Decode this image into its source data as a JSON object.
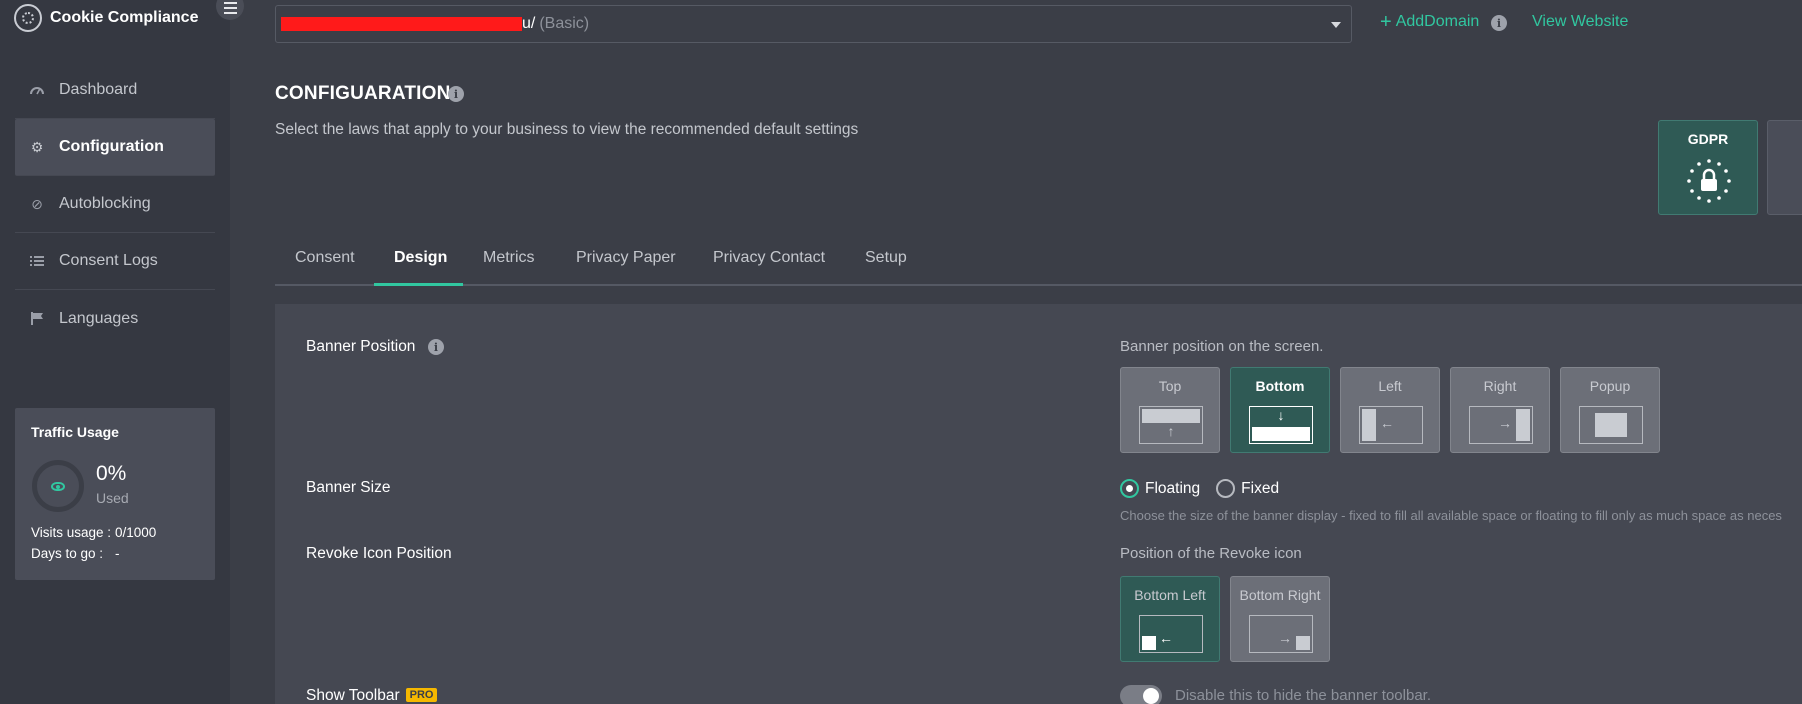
{
  "app": {
    "name": "Cookie Compliance"
  },
  "sidebar": {
    "items": [
      {
        "label": "Dashboard",
        "icon": "dashboard-icon"
      },
      {
        "label": "Configuration",
        "icon": "gear-icon",
        "active": true
      },
      {
        "label": "Autoblocking",
        "icon": "block-icon"
      },
      {
        "label": "Consent Logs",
        "icon": "list-icon"
      },
      {
        "label": "Languages",
        "icon": "flag-icon"
      }
    ],
    "traffic": {
      "title": "Traffic Usage",
      "percent": "0%",
      "used_label": "Used",
      "visits_label": "Visits usage :",
      "visits_value": "0/1000",
      "days_label": "Days to go :",
      "days_value": "-"
    }
  },
  "topbar": {
    "domain_suffix": "u/",
    "domain_plan": "(Basic)",
    "add_domain": "AddDomain",
    "view_website": "View Website"
  },
  "header": {
    "title": "CONFIGUARATION",
    "subtitle": "Select the laws that apply to your business to view the recommended default settings",
    "laws": [
      {
        "name": "GDPR",
        "selected": true
      }
    ]
  },
  "tabs": [
    {
      "label": "Consent"
    },
    {
      "label": "Design",
      "active": true
    },
    {
      "label": "Metrics"
    },
    {
      "label": "Privacy Paper"
    },
    {
      "label": "Privacy Contact"
    },
    {
      "label": "Setup"
    }
  ],
  "design": {
    "banner_position": {
      "label": "Banner Position",
      "hint": "Banner position on the screen.",
      "options": [
        {
          "label": "Top"
        },
        {
          "label": "Bottom",
          "selected": true
        },
        {
          "label": "Left"
        },
        {
          "label": "Right"
        },
        {
          "label": "Popup"
        }
      ]
    },
    "banner_size": {
      "label": "Banner Size",
      "options": [
        {
          "label": "Floating",
          "checked": true
        },
        {
          "label": "Fixed",
          "checked": false
        }
      ],
      "description": "Choose the size of the banner display - fixed to fill all available space or floating to fill only as much space as neces"
    },
    "revoke_icon": {
      "label": "Revoke Icon Position",
      "hint": "Position of the Revoke icon",
      "options": [
        {
          "label": "Bottom Left",
          "selected": true
        },
        {
          "label": "Bottom Right"
        }
      ]
    },
    "toolbar": {
      "label": "Show Toolbar",
      "badge": "PRO",
      "description": "Disable this to hide the banner toolbar."
    }
  },
  "colors": {
    "accent": "#31c7a0",
    "selected_card": "#2f5a55",
    "sidebar_bg": "#353841",
    "page_bg": "#3b3e47",
    "redaction": "#ff1a1a",
    "pro_badge": "#f5b800"
  }
}
